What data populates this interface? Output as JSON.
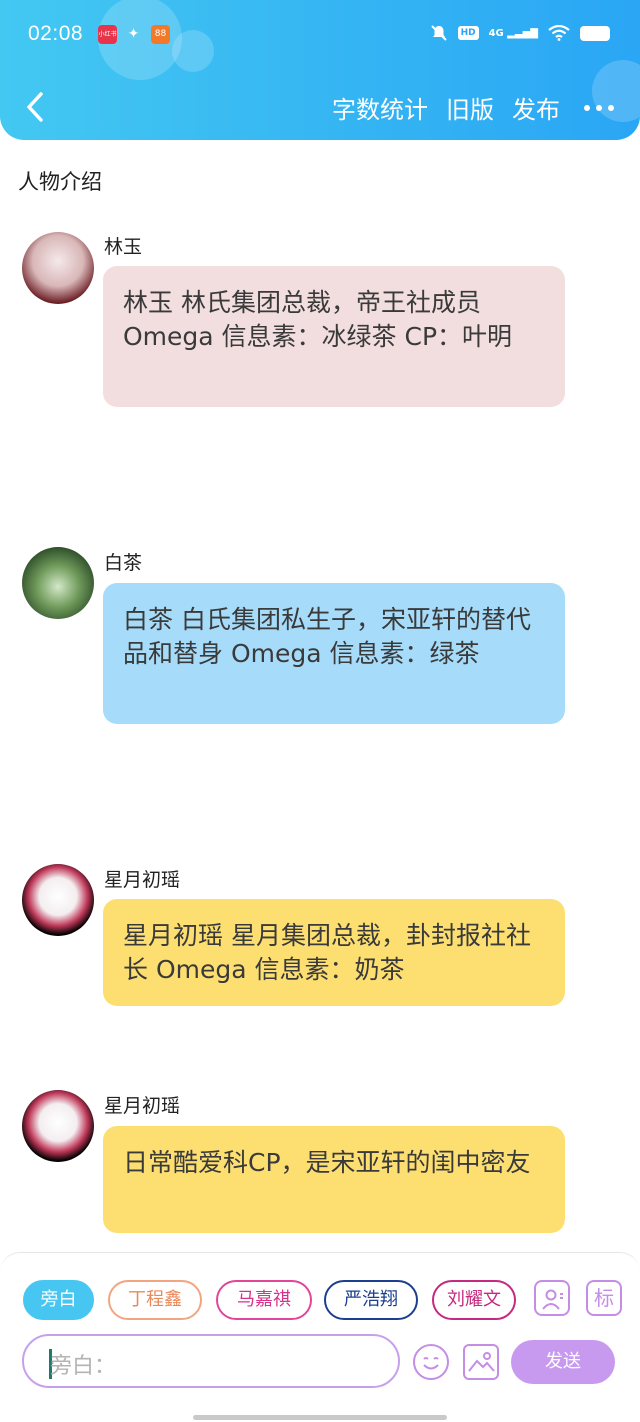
{
  "status_bar": {
    "time": "02:08",
    "app_badge_1": "小红书",
    "app_badge_2": "微信",
    "app_badge_3": "88",
    "hd": "HD",
    "signal": "4G"
  },
  "nav": {
    "word_count": "字数统计",
    "old_version": "旧版",
    "publish": "发布"
  },
  "section_title": "人物介绍",
  "messages": [
    {
      "speaker": "林玉",
      "text": "林玉 林氏集团总裁，帝王社成员Omega 信息素：冰绿茶 CP：叶明",
      "color": "#f2dede"
    },
    {
      "speaker": "白茶",
      "text": "白茶 白氏集团私生子，宋亚轩的替代品和替身 Omega 信息素：绿茶",
      "color": "#a6dcf9"
    },
    {
      "speaker": "星月初瑶",
      "text": "星月初瑶 星月集团总裁，卦封报社社长 Omega 信息素：奶茶",
      "color": "#fddf71"
    },
    {
      "speaker": "星月初瑶",
      "text": "日常酷爱科CP，是宋亚轩的闺中密友",
      "color": "#fddf71"
    }
  ],
  "bottom": {
    "chips": [
      "旁白",
      "丁程鑫",
      "马嘉祺",
      "严浩翔",
      "刘耀文"
    ],
    "tag_icon": "标",
    "input_placeholder": "旁白：",
    "send": "发送"
  }
}
